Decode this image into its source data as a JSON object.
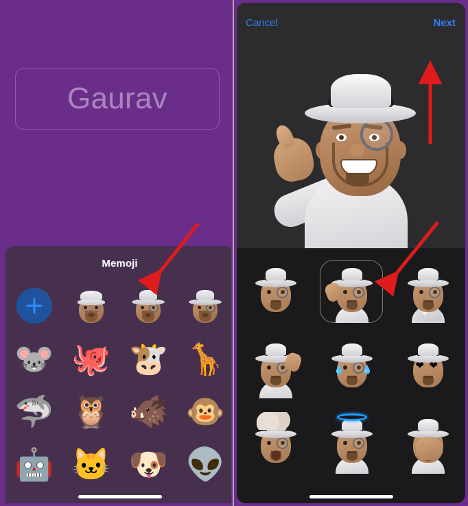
{
  "meta": {
    "title": "iPhone Memoji sticker selection screens",
    "colors": {
      "purple_background": "#6b2d8a",
      "memoji_sheet": "#46304e",
      "dark_app": "#2c2c2e",
      "sticker_grid": "#1a1a1c",
      "accent_blue": "#2f7ef3",
      "add_button_blue": "#20539e",
      "annotation_red": "#e01b1b"
    }
  },
  "left_screen": {
    "name_field": {
      "value": "Gaurav",
      "placeholder": "Gaurav"
    },
    "memoji_sheet": {
      "title": "Memoji",
      "add_button_label": "+",
      "items": [
        {
          "name": "add-memoji",
          "type": "add",
          "label": "+"
        },
        {
          "name": "memoji-beanie-glasses",
          "type": "memoji",
          "hat": "beanie",
          "label": "Memoji with beanie and glasses"
        },
        {
          "name": "memoji-fedora-monocle-1",
          "type": "memoji",
          "hat": "fedora",
          "label": "Memoji with fedora and monocle"
        },
        {
          "name": "memoji-fedora-monocle-2",
          "type": "memoji",
          "hat": "fedora",
          "label": "Memoji with fedora and monocle"
        },
        {
          "name": "animoji-mouse",
          "type": "emoji",
          "glyph": "🐭",
          "label": "Mouse"
        },
        {
          "name": "animoji-octopus",
          "type": "emoji",
          "glyph": "🐙",
          "label": "Octopus"
        },
        {
          "name": "animoji-cow",
          "type": "emoji",
          "glyph": "🐮",
          "label": "Cow"
        },
        {
          "name": "animoji-giraffe",
          "type": "emoji",
          "glyph": "🦒",
          "label": "Giraffe"
        },
        {
          "name": "animoji-shark",
          "type": "emoji",
          "glyph": "🦈",
          "label": "Shark"
        },
        {
          "name": "animoji-owl",
          "type": "emoji",
          "glyph": "🦉",
          "label": "Owl"
        },
        {
          "name": "animoji-boar",
          "type": "emoji",
          "glyph": "🐗",
          "label": "Boar"
        },
        {
          "name": "animoji-monkey",
          "type": "emoji",
          "glyph": "🐵",
          "label": "Monkey"
        },
        {
          "name": "animoji-robot",
          "type": "emoji",
          "glyph": "🤖",
          "label": "Robot"
        },
        {
          "name": "animoji-cat",
          "type": "emoji",
          "glyph": "🐱",
          "label": "Cat"
        },
        {
          "name": "animoji-dog",
          "type": "emoji",
          "glyph": "🐶",
          "label": "Dog"
        },
        {
          "name": "animoji-alien",
          "type": "emoji",
          "glyph": "👽",
          "label": "Alien"
        }
      ]
    }
  },
  "right_screen": {
    "header": {
      "cancel_label": "Cancel",
      "next_label": "Next"
    },
    "preview": {
      "label": "Memoji shaka / call-me gesture with fedora and monocle"
    },
    "stickers": [
      {
        "name": "sticker-monocle-face",
        "variant": "plain",
        "selected": false,
        "label": "Monocle face"
      },
      {
        "name": "sticker-shaka-thumb",
        "variant": "shaka",
        "selected": true,
        "label": "Shaka hand gesture"
      },
      {
        "name": "sticker-heart-hands",
        "variant": "hearthands",
        "selected": false,
        "label": "Heart hands"
      },
      {
        "name": "sticker-waving",
        "variant": "wave",
        "selected": false,
        "label": "Waving hand"
      },
      {
        "name": "sticker-laughing-tears",
        "variant": "tears",
        "selected": false,
        "label": "Laughing with tears of joy"
      },
      {
        "name": "sticker-heart-eyes",
        "variant": "hearteyes",
        "selected": false,
        "label": "Heart eyes"
      },
      {
        "name": "sticker-mind-blown",
        "variant": "mindblown",
        "selected": false,
        "label": "Mind blown"
      },
      {
        "name": "sticker-halo",
        "variant": "halo",
        "selected": false,
        "label": "Angel halo"
      },
      {
        "name": "sticker-face-palm",
        "variant": "facepalm",
        "selected": false,
        "label": "Hands covering face"
      }
    ]
  },
  "annotations": [
    {
      "name": "arrow-to-memoji-row",
      "direction": "down-left",
      "target": "Memoji avatar row"
    },
    {
      "name": "arrow-to-next-button",
      "direction": "up",
      "target": "Next button"
    },
    {
      "name": "arrow-to-sticker-grid",
      "direction": "down-left",
      "target": "Sticker grid"
    }
  ]
}
